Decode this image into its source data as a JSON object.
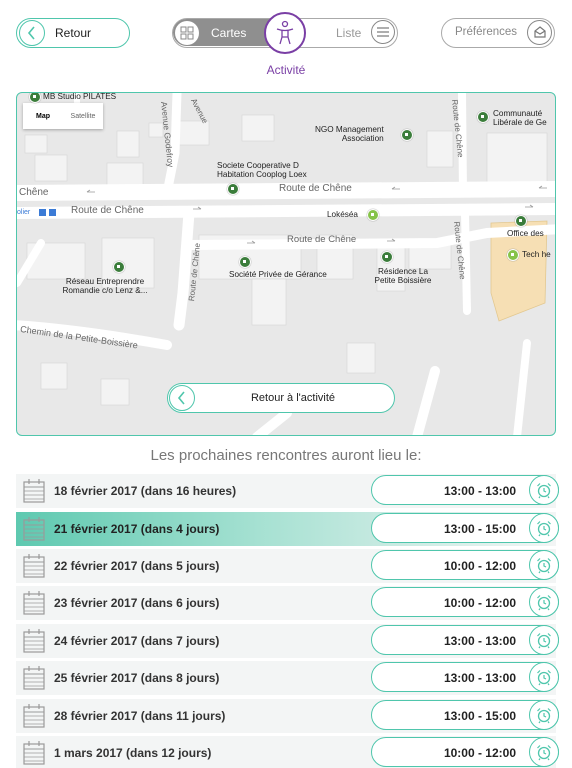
{
  "header": {
    "back_label": "Retour",
    "tab_cartes": "Cartes",
    "tab_liste": "Liste",
    "activity_label": "Activité",
    "preferences_label": "Préférences"
  },
  "map": {
    "type_map": "Map",
    "type_satellite": "Satellite",
    "back_to_activity": "Retour à l'activité",
    "pois": {
      "mb_studio": "MB Studio PILATES",
      "ngo": "NGO Management\nAssociation",
      "communaute": "Communauté\nLibérale de Ge",
      "cooperative": "Societe Cooperative D\nHabitation Cooplog Loex",
      "lokesea": "Lokéséa",
      "office": "Office des",
      "tech": "Tech he",
      "reseau": "Réseau Entreprendre\nRomandie c/o Lenz &...",
      "societe_privee": "Société Privée de Gérance",
      "residence": "Résidence La\nPetite Boissière",
      "olier": "olier"
    },
    "roads": {
      "route_chene_1": "Route de Chêne",
      "route_chene_2": "Route de Chêne",
      "route_chene_3": "Route de Chêne",
      "chene": "Chêne",
      "avenue_godefroy": "Avenue Godefroy",
      "avenue": "Avenue",
      "route_chene_v1": "Route de Chêne",
      "route_chene_v2": "Route de Chêne",
      "route_chene_v3": "Route de Chêne",
      "chemin": "Chemin de la Petite-Boissière"
    }
  },
  "sessions": {
    "title": "Les prochaines rencontres auront lieu le:",
    "rows": [
      {
        "date": "18 février 2017 (dans 16 heures)",
        "time": "13:00 - 13:00",
        "selected": false
      },
      {
        "date": "21 février 2017 (dans 4 jours)",
        "time": "13:00 - 15:00",
        "selected": true
      },
      {
        "date": "22 février 2017 (dans 5 jours)",
        "time": "10:00 - 12:00",
        "selected": false
      },
      {
        "date": "23 février 2017 (dans 6 jours)",
        "time": "10:00 - 12:00",
        "selected": false
      },
      {
        "date": "24 février 2017 (dans 7 jours)",
        "time": "13:00 - 13:00",
        "selected": false
      },
      {
        "date": "25 février 2017 (dans 8 jours)",
        "time": "13:00 - 13:00",
        "selected": false
      },
      {
        "date": "28 février 2017 (dans 11 jours)",
        "time": "13:00 - 15:00",
        "selected": false
      },
      {
        "date": "1 mars 2017 (dans 12 jours)",
        "time": "10:00 - 12:00",
        "selected": false
      }
    ]
  },
  "colors": {
    "accent": "#4fc6ac",
    "activity": "#7a3fa5",
    "selected_row": "#5ec9b0"
  }
}
